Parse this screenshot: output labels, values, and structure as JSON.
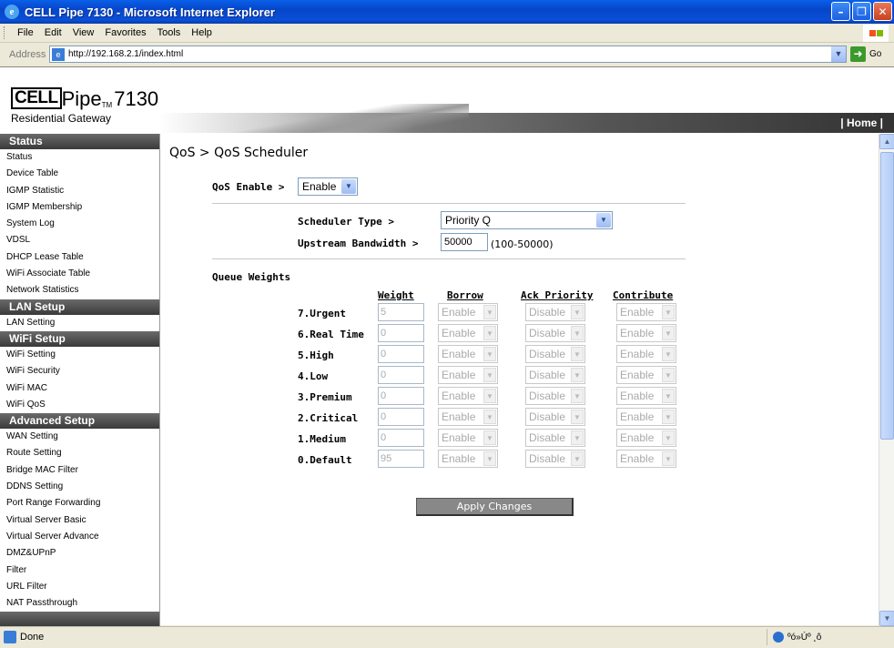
{
  "window": {
    "title": "CELL Pipe 7130 - Microsoft Internet Explorer"
  },
  "menu": [
    "File",
    "Edit",
    "View",
    "Favorites",
    "Tools",
    "Help"
  ],
  "address": {
    "label": "Address",
    "url": "http://192.168.2.1/index.html",
    "go_label": "Go"
  },
  "header": {
    "logo_cell": "CELL",
    "logo_pipe": "Pipe",
    "logo_tm": "TM",
    "logo_model": "7130",
    "logo_sub": "Residential Gateway",
    "home_link": "| Home |"
  },
  "sidebar": {
    "sections": [
      {
        "title": "Status",
        "items": [
          "Status",
          "Device Table",
          "IGMP Statistic",
          "IGMP Membership",
          "System Log",
          "VDSL",
          "DHCP Lease Table",
          "WiFi Associate Table",
          "Network Statistics"
        ]
      },
      {
        "title": "LAN Setup",
        "items": [
          "LAN Setting"
        ]
      },
      {
        "title": "WiFi Setup",
        "items": [
          "WiFi Setting",
          "WiFi Security",
          "WiFi MAC",
          "WiFi QoS"
        ]
      },
      {
        "title": "Advanced Setup",
        "items": [
          "WAN Setting",
          "Route Setting",
          "Bridge MAC Filter",
          "DDNS Setting",
          "Port Range Forwarding",
          "Virtual Server Basic",
          "Virtual Server Advance",
          "DMZ&UPnP",
          "Filter",
          "URL Filter",
          "NAT Passthrough"
        ]
      }
    ]
  },
  "main": {
    "title": "QoS > QoS Scheduler",
    "qos_enable": {
      "label": "QoS Enable >",
      "value": "Enable"
    },
    "scheduler_type": {
      "label": "Scheduler Type >",
      "value": "Priority Q"
    },
    "upstream_bandwidth": {
      "label": "Upstream Bandwidth >",
      "value": "50000",
      "range": "(100-50000)"
    },
    "queue_weights": {
      "heading": "Queue Weights",
      "columns": [
        "Weight",
        "Borrow",
        "Ack Priority",
        "Contribute"
      ],
      "rows": [
        {
          "name": "7.Urgent",
          "weight": "5",
          "borrow": "Enable",
          "ack": "Disable",
          "contribute": "Enable"
        },
        {
          "name": "6.Real Time",
          "weight": "0",
          "borrow": "Enable",
          "ack": "Disable",
          "contribute": "Enable"
        },
        {
          "name": "5.High",
          "weight": "0",
          "borrow": "Enable",
          "ack": "Disable",
          "contribute": "Enable"
        },
        {
          "name": "4.Low",
          "weight": "0",
          "borrow": "Enable",
          "ack": "Disable",
          "contribute": "Enable"
        },
        {
          "name": "3.Premium",
          "weight": "0",
          "borrow": "Enable",
          "ack": "Disable",
          "contribute": "Enable"
        },
        {
          "name": "2.Critical",
          "weight": "0",
          "borrow": "Enable",
          "ack": "Disable",
          "contribute": "Enable"
        },
        {
          "name": "1.Medium",
          "weight": "0",
          "borrow": "Enable",
          "ack": "Disable",
          "contribute": "Enable"
        },
        {
          "name": "0.Default",
          "weight": "95",
          "borrow": "Enable",
          "ack": "Disable",
          "contribute": "Enable"
        }
      ]
    },
    "apply_label": "Apply Changes"
  },
  "statusbar": {
    "text": "Done",
    "zone": "ºó»Úº ¸ô"
  },
  "colors": {
    "title_blue": "#0646c9",
    "sidebar_head": "#4a4a4a",
    "apply_button": "#888888"
  }
}
